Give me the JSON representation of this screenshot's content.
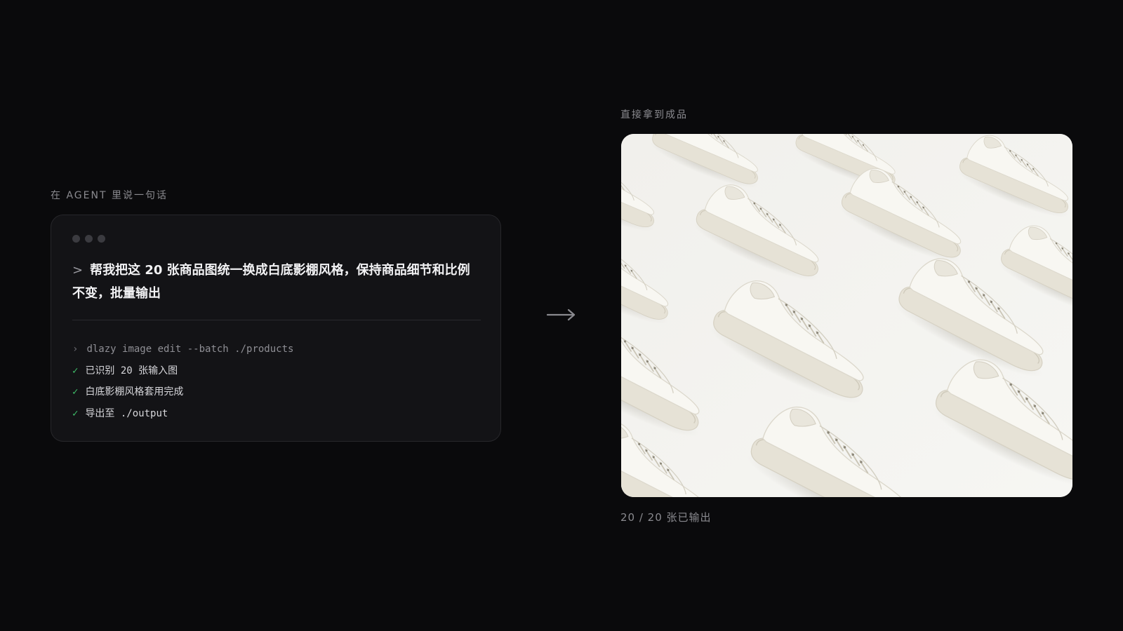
{
  "left": {
    "label": "在 AGENT 里说一句话",
    "prompt_caret": ">",
    "prompt_text": "帮我把这 20 张商品图统一换成白底影棚风格，保持商品细节和比例不变，批量输出",
    "command_chevron": "›",
    "command": "dlazy image edit --batch ./products",
    "log": [
      {
        "mark": "✓",
        "text": "已识别 20 张输入图"
      },
      {
        "mark": "✓",
        "text": "白底影棚风格套用完成"
      },
      {
        "mark": "✓",
        "text": "导出至 ./output"
      }
    ]
  },
  "arrow": {
    "icon": "arrow-right-icon"
  },
  "right": {
    "label": "直接拿到成品",
    "image_subject": "white-sneakers-grid",
    "counter": "20 / 20 张已输出"
  },
  "colors": {
    "background": "#0a0a0c",
    "card": "#131316",
    "check": "#3fbf6a",
    "muted": "#8a8a8f"
  }
}
